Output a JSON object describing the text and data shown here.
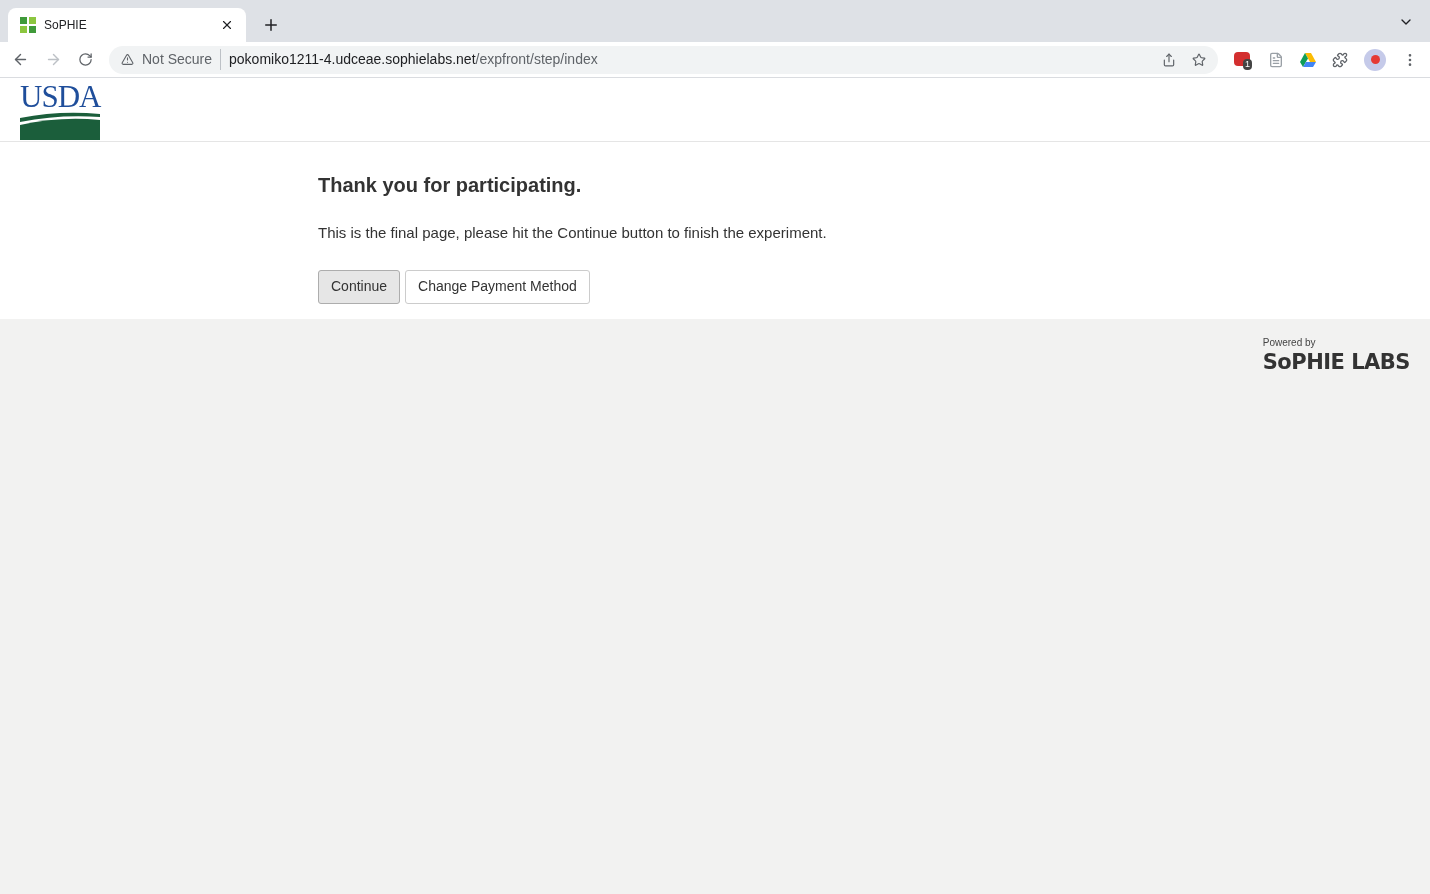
{
  "browser": {
    "tab": {
      "title": "SoPHIE",
      "selected": true
    },
    "security": "Not Secure",
    "url_host": "pokomiko1211-4.udceae.sophielabs.net",
    "url_path": "/expfront/step/index",
    "extension_badge": "1"
  },
  "header": {
    "logo_text": "USDA"
  },
  "content": {
    "heading": "Thank you for participating.",
    "message": "This is the final page, please hit the Continue button to finish the experiment.",
    "buttons": [
      {
        "label": "Continue",
        "highlighted": true
      },
      {
        "label": "Change Payment Method",
        "highlighted": false
      }
    ]
  },
  "footer": {
    "powered_by": "Powered by",
    "brand": "SoPHIE LABS"
  }
}
